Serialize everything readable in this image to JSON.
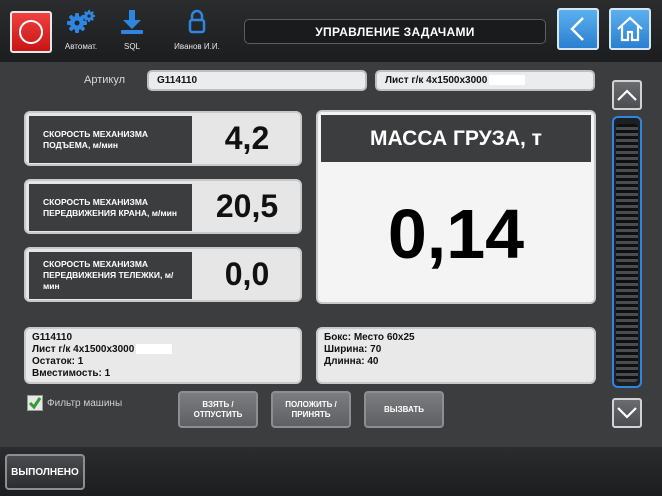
{
  "header": {
    "title": "УПРАВЛЕНИЕ ЗАДАЧАМИ",
    "tools": [
      {
        "label": "Автомат.",
        "icon": "gears-icon"
      },
      {
        "label": "SQL",
        "icon": "download-icon"
      },
      {
        "label": "Иванов И.И.",
        "icon": "lock-icon"
      }
    ]
  },
  "article": {
    "label": "Артикул",
    "code": "G114110",
    "name": "Лист г/к 4х1500х3000"
  },
  "speeds": [
    {
      "label": "СКОРОСТЬ МЕХАНИЗМА ПОДЪЕМА, м/мин",
      "value": "4,2"
    },
    {
      "label": "СКОРОСТЬ МЕХАНИЗМА ПЕРЕДВИЖЕНИЯ КРАНА, м/мин",
      "value": "20,5"
    },
    {
      "label": "СКОРОСТЬ МЕХАНИЗМА ПЕРЕДВИЖЕНИЯ ТЕЛЕЖКИ, м/мин",
      "value": "0,0"
    }
  ],
  "mass": {
    "title": "МАССА ГРУЗА, т",
    "value": "0,14"
  },
  "item_info": {
    "code": "G114110",
    "name": "Лист г/к 4х1500х3000",
    "remainder": "Остаток: 1",
    "capacity": "Вместимость: 1"
  },
  "box_info": {
    "box": "Бокс: Место 60х25",
    "width": "Ширина: 70",
    "length": "Длинна: 40"
  },
  "filter": {
    "label": "Фильтр машины",
    "checked": true
  },
  "actions": {
    "take": "ВЗЯТЬ / ОТПУСТИТЬ",
    "place": "ПОЛОЖИТЬ / ПРИНЯТЬ",
    "call": "ВЫЗВАТЬ"
  },
  "footer": {
    "done": "ВЫПОЛНЕНО"
  },
  "colors": {
    "accent_blue": "#2a7fd0",
    "stop_red": "#d81e1e",
    "check_green": "#2e9e2e"
  }
}
